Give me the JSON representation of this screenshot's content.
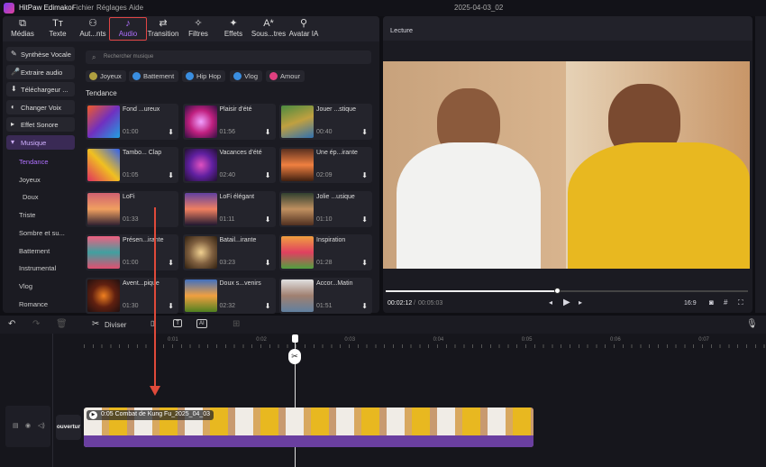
{
  "app": {
    "title": "HitPaw Edimakor",
    "menus": [
      "Fichier",
      "Réglages",
      "Aide"
    ],
    "project": "2025-04-03_02"
  },
  "toolbar": [
    {
      "label": "Médias",
      "icon": "media-icon"
    },
    {
      "label": "Texte",
      "icon": "text-icon"
    },
    {
      "label": "Aut...nts",
      "icon": "elements-icon"
    },
    {
      "label": "Audio",
      "icon": "music-note-icon",
      "active": true
    },
    {
      "label": "Transition",
      "icon": "transition-icon"
    },
    {
      "label": "Filtres",
      "icon": "filter-icon"
    },
    {
      "label": "Effets",
      "icon": "effects-icon"
    },
    {
      "label": "Sous...tres",
      "icon": "subtitle-icon"
    },
    {
      "label": "Avatar IA",
      "icon": "avatar-icon"
    }
  ],
  "sidebar": {
    "buttons": [
      "Synthèse Vocale",
      "Extraire audio",
      "Téléchargeur ...",
      "Changer Voix",
      "Effet Sonore",
      "Musique"
    ],
    "sub": [
      "Tendance",
      "Joyeux",
      "Doux",
      "Triste",
      "Sombre et su...",
      "Battement",
      "Instrumental",
      "Vlog",
      "Romance"
    ]
  },
  "search": {
    "placeholder": "Rechercher musique"
  },
  "chips": [
    {
      "label": "Joyeux",
      "color": "#b0a040"
    },
    {
      "label": "Battement",
      "color": "#3a8ee0"
    },
    {
      "label": "Hip Hop",
      "color": "#3a8ee0"
    },
    {
      "label": "Vlog",
      "color": "#3a8ee0"
    },
    {
      "label": "Amour",
      "color": "#e04080"
    }
  ],
  "section": "Tendance",
  "tracks": [
    {
      "title": "Fond ...ureux",
      "dur": "01:00"
    },
    {
      "title": "Plaisir d'été",
      "dur": "01:56"
    },
    {
      "title": "Jouer ...stique",
      "dur": "00:40"
    },
    {
      "title": "Tambo... Clap",
      "dur": "01:05"
    },
    {
      "title": "Vacances d'été",
      "dur": "02:40"
    },
    {
      "title": "Une ép...irante",
      "dur": "02:09"
    },
    {
      "title": "LoFi",
      "dur": "01:33"
    },
    {
      "title": "LoFi élégant",
      "dur": "01:11"
    },
    {
      "title": "Jolie ...usique",
      "dur": "01:10"
    },
    {
      "title": "Présen...irante",
      "dur": "01:00"
    },
    {
      "title": "Batail...irante",
      "dur": "03:23"
    },
    {
      "title": "Inspiration",
      "dur": "01:28"
    },
    {
      "title": "Avent...pique",
      "dur": "01:30"
    },
    {
      "title": "Doux s...venirs",
      "dur": "02:32"
    },
    {
      "title": "Accor...Matin",
      "dur": "01:51"
    }
  ],
  "preview": {
    "title": "Lecture",
    "current": "00:02:12",
    "total": "00:05:03",
    "ratio": "16:9",
    "progress": 0.43
  },
  "timeline": {
    "split": "Diviser",
    "ticks": [
      "0:01",
      "0:02",
      "0:03",
      "0:04",
      "0:05",
      "0:06",
      "0:07"
    ],
    "track_label": "ouvertur",
    "clip": "0:05 Combat de Kung Fu_2025_04_03"
  },
  "accent": "#b070ff"
}
